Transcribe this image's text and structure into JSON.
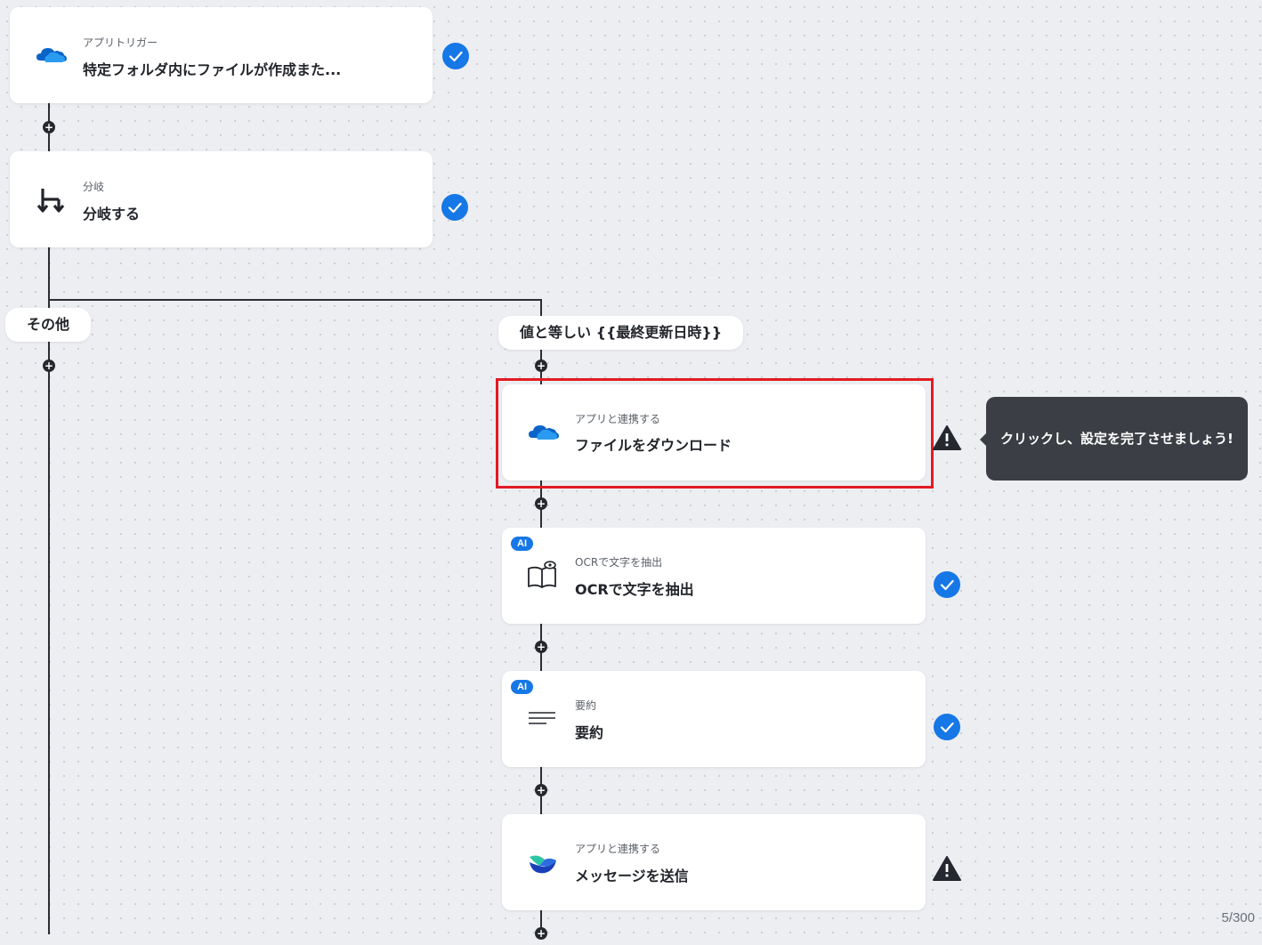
{
  "nodes": [
    {
      "id": "trigger",
      "subtitle": "アプリトリガー",
      "title": "特定フォルダ内にファイルが作成また...",
      "status": "check",
      "icon": "onedrive-icon"
    },
    {
      "id": "branch",
      "subtitle": "分岐",
      "title": "分岐する",
      "status": "check",
      "icon": "branch-icon"
    },
    {
      "id": "download",
      "subtitle": "アプリと連携する",
      "title": "ファイルをダウンロード",
      "status": "warning",
      "icon": "onedrive-icon"
    },
    {
      "id": "ocr",
      "subtitle": "OCRで文字を抽出",
      "title": "OCRで文字を抽出",
      "status": "check",
      "icon": "ocr-book-icon",
      "badge": "AI"
    },
    {
      "id": "summary",
      "subtitle": "要約",
      "title": "要約",
      "status": "check",
      "icon": "text-lines-icon",
      "badge": "AI"
    },
    {
      "id": "message",
      "subtitle": "アプリと連携する",
      "title": "メッセージを送信",
      "status": "warning",
      "icon": "chatwork-icon"
    }
  ],
  "branches": {
    "other_label": "その他",
    "condition_label": "値と等しい {{最終更新日時}}"
  },
  "tooltip": {
    "text": "クリックし、設定を完了させましょう!"
  },
  "counter": "5/300",
  "colors": {
    "accent": "#1677e6",
    "highlight": "#e21b23",
    "dark": "#2a2d33"
  }
}
